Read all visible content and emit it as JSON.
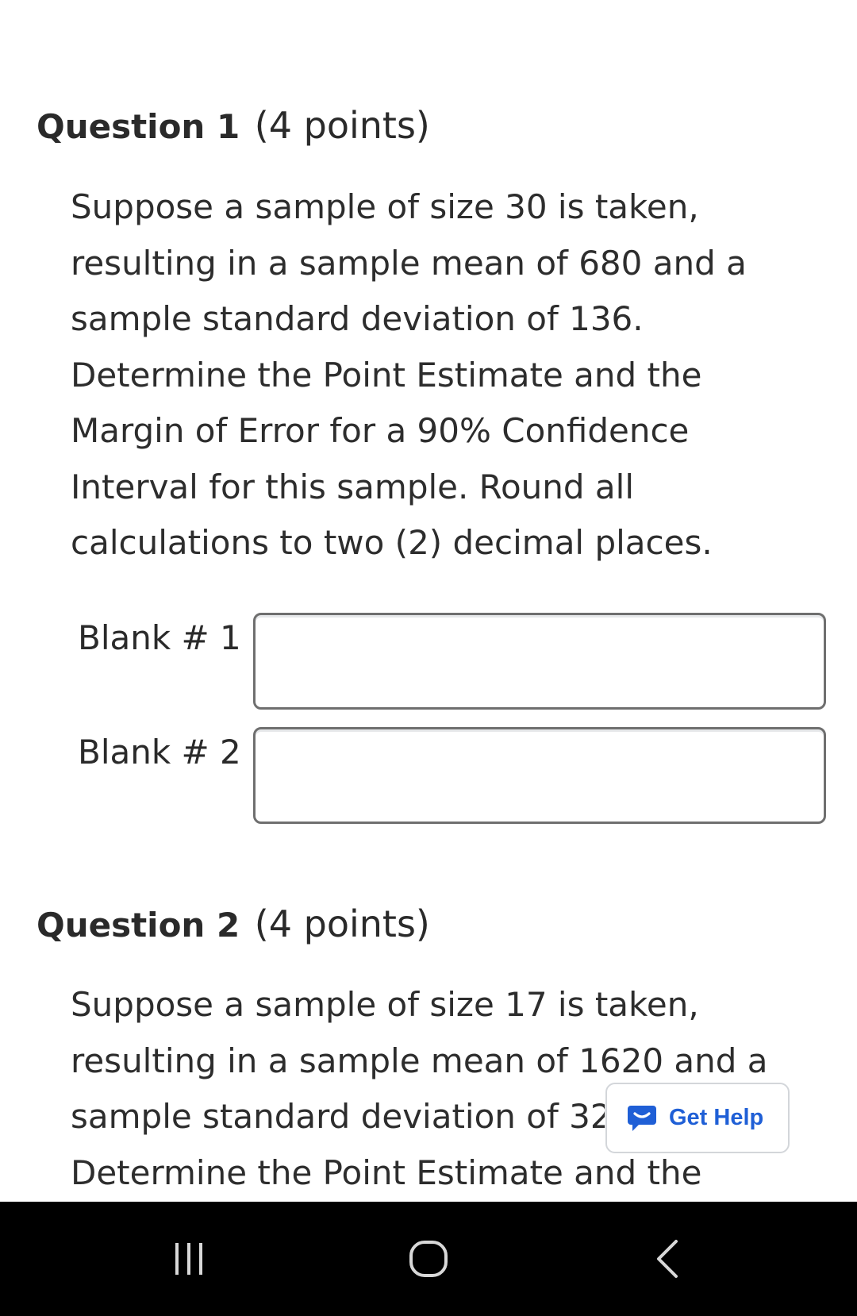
{
  "questions": [
    {
      "title": "Question 1",
      "points": "(4 points)",
      "text_lines": [
        "Suppose a sample of size 30 is taken,",
        "resulting in a sample mean of 680 and a",
        "sample standard deviation of 136.",
        "Determine the Point Estimate and the",
        "Margin of Error for a 90% Confidence",
        "Interval for this sample. Round all",
        "calculations to two (2) decimal places."
      ],
      "blanks": [
        {
          "label": "Blank # 1",
          "value": ""
        },
        {
          "label": "Blank # 2",
          "value": ""
        }
      ]
    },
    {
      "title": "Question 2",
      "points": "(4 points)",
      "text_lines": [
        "Suppose a sample of size 17 is taken,",
        "resulting in a sample mean of 1620 and a",
        "sample standard deviation of 32",
        "Determine the Point Estimate and the"
      ]
    }
  ],
  "get_help": {
    "label": "Get Help",
    "icon": "chat-bubble-icon",
    "color": "#1f5fd6"
  },
  "nav_bar": {
    "recents_icon": "recent-apps-icon",
    "home_icon": "home-icon",
    "back_icon": "back-chevron-icon"
  },
  "colors": {
    "text": "#2a2a2a",
    "input_border": "#6f6f6f",
    "nav_background": "#000000",
    "nav_icon": "#d8d8d8"
  }
}
